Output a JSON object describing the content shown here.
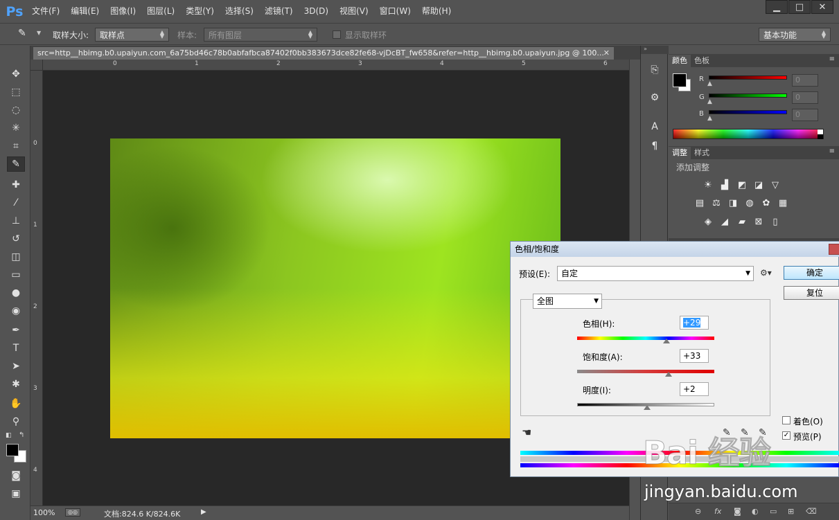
{
  "app": {
    "logo": "Ps"
  },
  "menu": [
    "文件(F)",
    "编辑(E)",
    "图像(I)",
    "图层(L)",
    "类型(Y)",
    "选择(S)",
    "滤镜(T)",
    "3D(D)",
    "视图(V)",
    "窗口(W)",
    "帮助(H)"
  ],
  "window_controls": {
    "minimize": "▁",
    "restore": "□",
    "close": "✕"
  },
  "options": {
    "sample_size_label": "取样大小:",
    "sample_size_value": "取样点",
    "sample_label": "样本:",
    "sample_value": "所有图层",
    "show_ring_label": "显示取样环",
    "workspace": "基本功能"
  },
  "document": {
    "tab_title": "src=http__hbimg.b0.upaiyun.com_6a75bd46c78b0abfafbca87402f0bb383673dce82fe68-vjDcBT_fw658&refer=http__hbimg.b0.upaiyun.jpg @ 100...",
    "close": "✕"
  },
  "ruler": {
    "h_labels": [
      "0",
      "1",
      "2",
      "3",
      "4",
      "5",
      "6"
    ],
    "v_labels": [
      "0",
      "1",
      "2",
      "3",
      "4"
    ]
  },
  "status": {
    "zoom": "100%",
    "doc_size": "文档:824.6 K/824.6K",
    "arrow": "▶"
  },
  "color_panel": {
    "tabs": [
      "颜色",
      "色板"
    ],
    "channels": [
      {
        "label": "R",
        "value": "0",
        "color": "#ff0000"
      },
      {
        "label": "G",
        "value": "0",
        "color": "#00ff00"
      },
      {
        "label": "B",
        "value": "0",
        "color": "#0000ff"
      }
    ]
  },
  "adjust_panel": {
    "tabs": [
      "调整",
      "样式"
    ],
    "title": "添加调整"
  },
  "dialog": {
    "title": "色相/饱和度",
    "preset_label": "预设(E):",
    "preset_value": "自定",
    "ok": "确定",
    "reset": "复位",
    "channel": "全图",
    "hue_label": "色相(H):",
    "hue_value": "+29",
    "hue_level": 0.65,
    "sat_label": "饱和度(A):",
    "sat_value": "+33",
    "sat_level": 0.665,
    "light_label": "明度(I):",
    "light_value": "+2",
    "light_level": 0.51,
    "colorize_label": "着色(O)",
    "preview_label": "预览(P)",
    "preview_checked": "✓"
  },
  "watermark": {
    "logo": "Bai 经验",
    "url": "jingyan.baidu.com"
  }
}
